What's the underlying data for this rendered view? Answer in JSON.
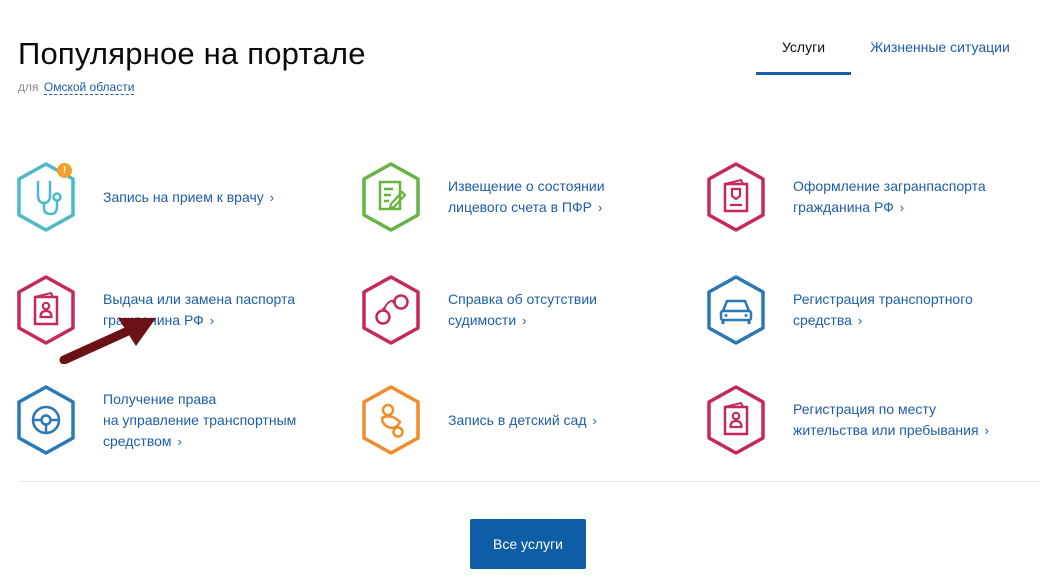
{
  "header": {
    "title": "Популярное на портале",
    "for_label": "для",
    "region_link": "Омской области"
  },
  "tabs": [
    {
      "label": "Услуги",
      "active": true
    },
    {
      "label": "Жизненные ситуации",
      "active": false
    }
  ],
  "services": [
    {
      "line1": "Запись на прием к врачу",
      "line2": "",
      "line3": "",
      "icon": "stethoscope-icon",
      "color": "#4bb9c9",
      "badge": "!"
    },
    {
      "line1": "Извещение о состоянии",
      "line2": "лицевого счета в ПФР",
      "line3": "",
      "icon": "document-edit-icon",
      "color": "#65b444"
    },
    {
      "line1": "Оформление загранпаспорта",
      "line2": "гражданина РФ",
      "line3": "",
      "icon": "foreign-passport-icon",
      "color": "#c6285d"
    },
    {
      "line1": "Выдача или замена паспорта",
      "line2": "гражданина РФ",
      "line3": "",
      "icon": "passport-icon",
      "color": "#c6285d"
    },
    {
      "line1": "Справка об отсутствии",
      "line2": "судимости",
      "line3": "",
      "icon": "handcuffs-icon",
      "color": "#c6285d"
    },
    {
      "line1": "Регистрация транспортного",
      "line2": "средства",
      "line3": "",
      "icon": "car-icon",
      "color": "#2a78b6"
    },
    {
      "line1": "Получение права",
      "line2": "на управление транспортным",
      "line3": "средством",
      "icon": "steering-wheel-icon",
      "color": "#2a78b6"
    },
    {
      "line1": "Запись в детский сад",
      "line2": "",
      "line3": "",
      "icon": "pacifier-icon",
      "color": "#f08c2a"
    },
    {
      "line1": "Регистрация по месту",
      "line2": "жительства или пребывания",
      "line3": "",
      "icon": "residence-passport-icon",
      "color": "#c6285d"
    }
  ],
  "all_services_button": "Все услуги",
  "chevron": "›",
  "annotation_arrow_color": "#6b1216"
}
